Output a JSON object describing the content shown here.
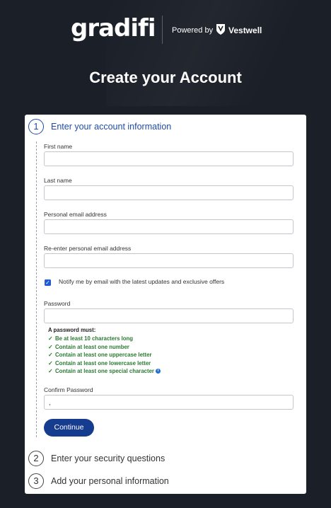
{
  "header": {
    "logo": "gradifi",
    "powered_by": "Powered by",
    "partner": "Vestwell"
  },
  "title": "Create your Account",
  "steps": [
    {
      "number": "1",
      "label": "Enter your account information"
    },
    {
      "number": "2",
      "label": "Enter your security questions"
    },
    {
      "number": "3",
      "label": "Add your personal information"
    }
  ],
  "form": {
    "first_name_label": "First name",
    "first_name_value": "",
    "last_name_label": "Last name",
    "last_name_value": "",
    "email_label": "Personal email address",
    "email_value": "",
    "email_confirm_label": "Re-enter personal email address",
    "email_confirm_value": "",
    "notify_label": "Notify me by email with the latest updates and exclusive offers",
    "notify_checked": true,
    "password_label": "Password",
    "password_value": "",
    "rules_heading": "A password must:",
    "rules": [
      "Be at least 10 characters long",
      "Contain at least one number",
      "Contain at least one uppercase letter",
      "Contain at least one lowercase letter",
      "Contain at least one special character"
    ],
    "rule_check_mark": "✓",
    "info_icon_glyph": "i",
    "confirm_password_label": "Confirm Password",
    "confirm_password_value": ",",
    "continue_label": "Continue"
  },
  "colors": {
    "background": "#1b1f27",
    "accent": "#1f4ba8",
    "button": "#163c8f",
    "rule_ok": "#2a7a33"
  }
}
